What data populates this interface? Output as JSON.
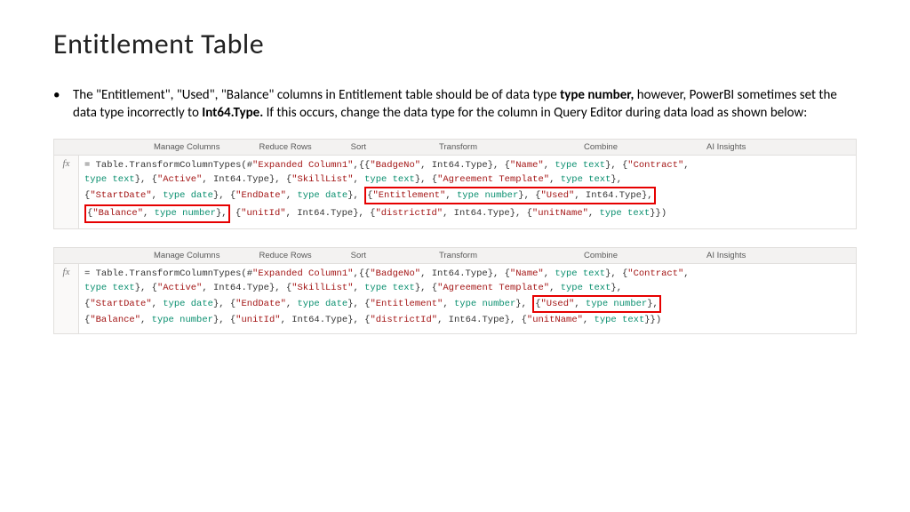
{
  "title": "Entitlement Table",
  "bullet": {
    "dot": "•",
    "t1": "The \"Entitlement\", \"Used\", \"Balance\" columns in Entitlement table should be of data type ",
    "b1": "type number,",
    "t2": " however, PowerBI sometimes set the data type incorrectly to ",
    "b2": "Int64.Type.",
    "t3": " If this occurs, change the data type for the column in Query Editor during data load as shown below:"
  },
  "ribbon": {
    "manage": "Manage Columns",
    "reduce": "Reduce Rows",
    "sort": "Sort",
    "transform": "Transform",
    "combine": "Combine",
    "ai": "AI Insights"
  },
  "fx": "fx",
  "code1": {
    "lead": "= Table.TransformColumnTypes(#",
    "expanded": "\"Expanded Column1\"",
    "comma": ",{{",
    "badge": "\"BadgeNo\"",
    "int64": "Int64.Type",
    "sep": "}, {",
    "name": "\"Name\"",
    "typetext": "type text",
    "contract": "\"Contract\"",
    "active": "\"Active\"",
    "skilllist": "\"SkillList\"",
    "agreement": "\"Agreement Template\"",
    "startdate": "\"StartDate\"",
    "typedate": "type date",
    "enddate": "\"EndDate\"",
    "entitlement": "\"Entitlement\"",
    "typenumber": "type number",
    "used": "\"Used\"",
    "balance": "\"Balance\"",
    "unitid": "\"unitId\"",
    "districtid": "\"districtId\"",
    "unitname": "\"unitName\"",
    "tail": "}})"
  }
}
